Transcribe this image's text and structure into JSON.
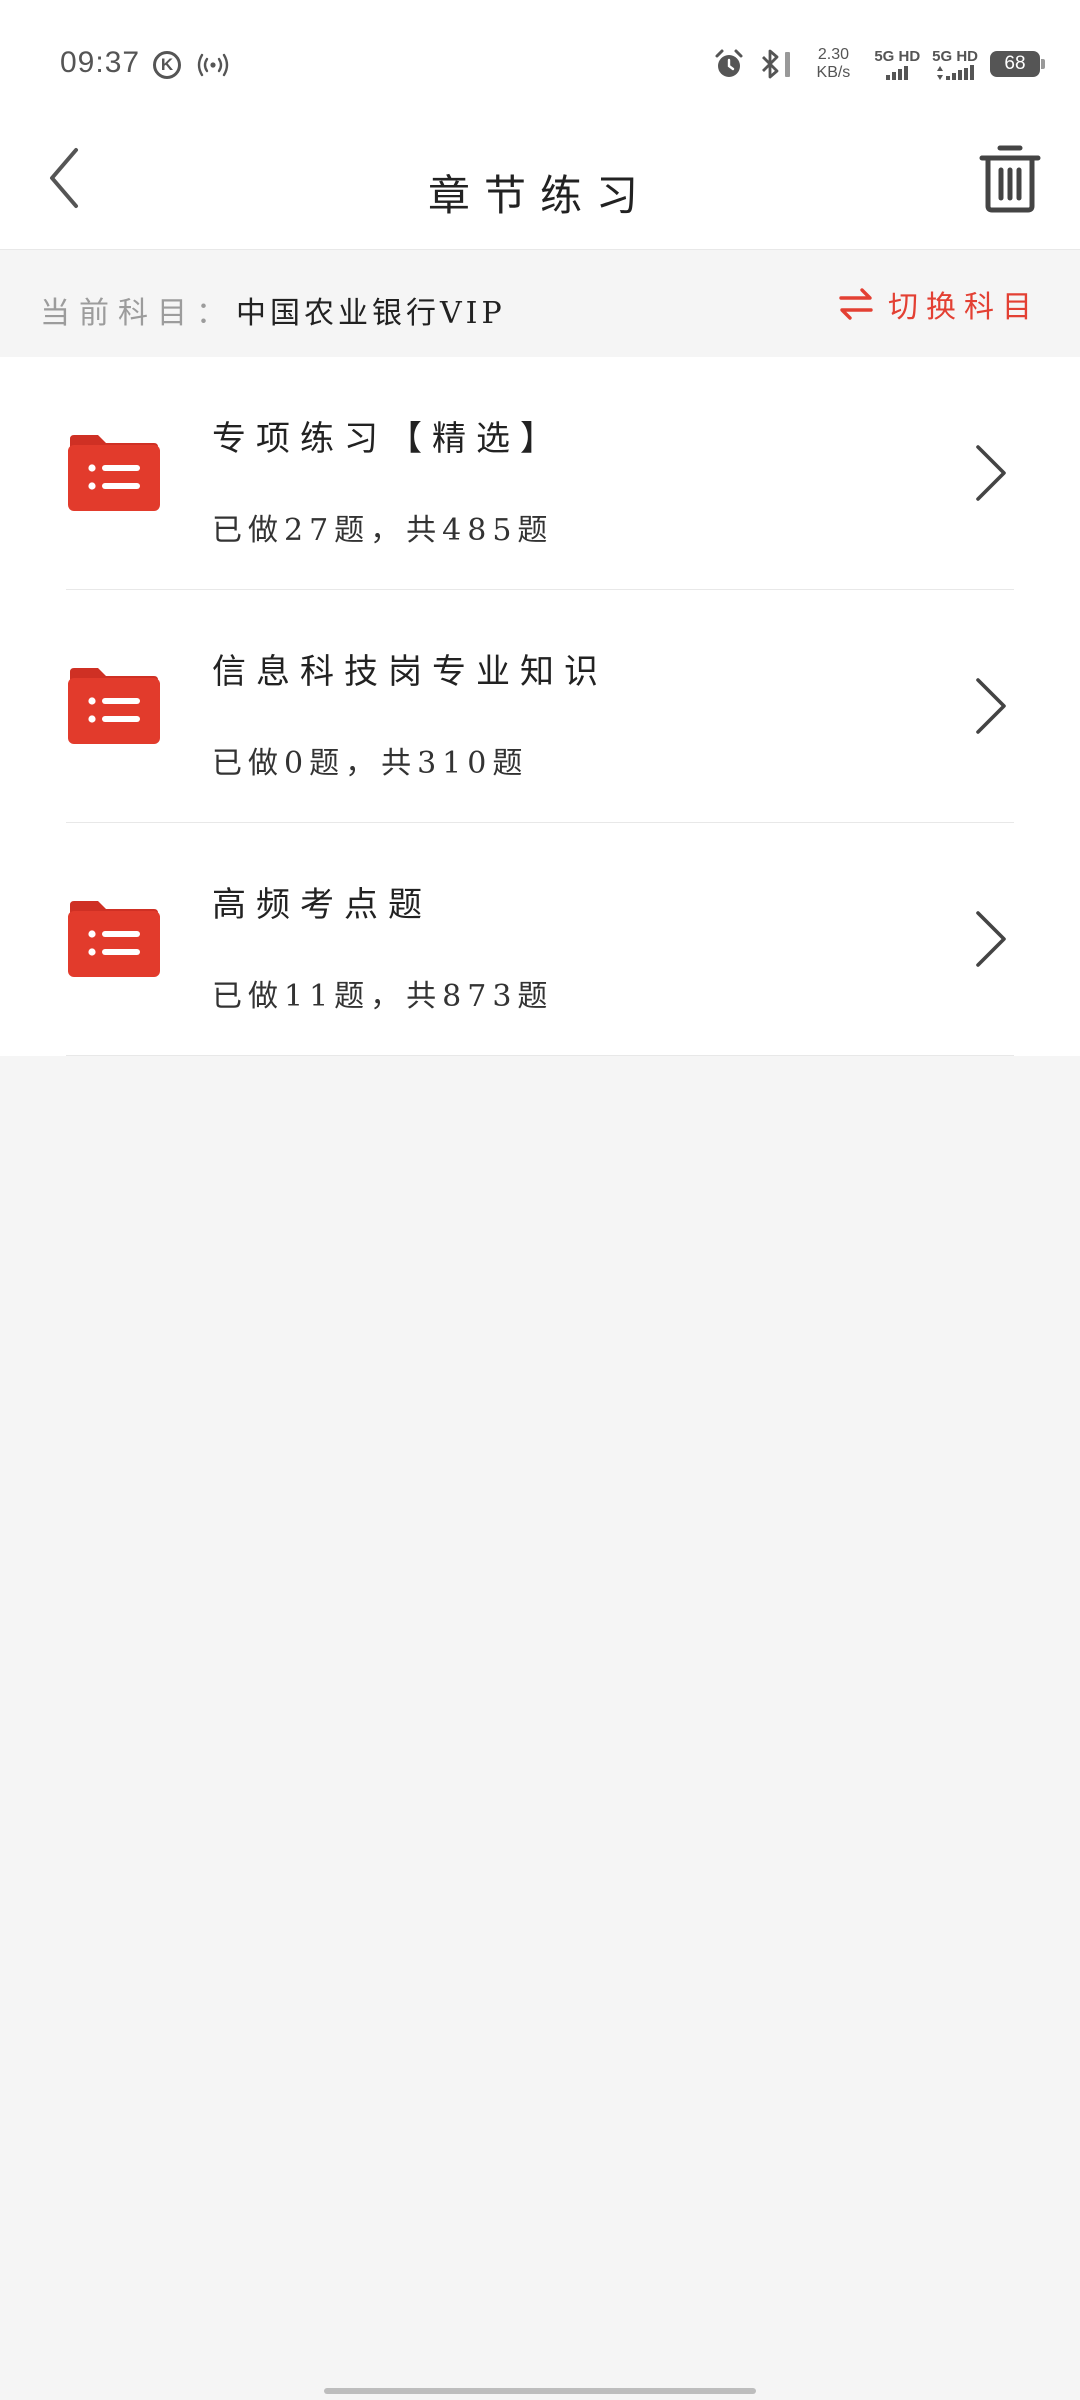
{
  "status_bar": {
    "time": "09:37",
    "k_badge": "K",
    "net_speed_value": "2.30",
    "net_speed_unit": "KB/s",
    "sim1_label": "5G HD",
    "sim2_label": "5G HD",
    "battery_level": "68",
    "icons": [
      "hotspot-icon",
      "alarm-icon",
      "bluetooth-icon",
      "signal-icon"
    ]
  },
  "header": {
    "title": "章节练习",
    "icons": [
      "chevron-left-icon",
      "trash-icon"
    ]
  },
  "subject_bar": {
    "prefix": "当前科目：",
    "subject": "中国农业银行VIP",
    "switch_label": "切换科目",
    "icons": [
      "swap-icon"
    ]
  },
  "sections": [
    {
      "title": "专项练习【精选】",
      "progress": "已做27题，共485题"
    },
    {
      "title": "信息科技岗专业知识",
      "progress": "已做0题，共310题"
    },
    {
      "title": "高频考点题",
      "progress": "已做11题，共873题"
    }
  ],
  "colors": {
    "accent": "#e34033",
    "folder": "#e23b2c",
    "background": "#f5f5f5",
    "surface": "#ffffff",
    "muted_text": "#9c9c9c"
  }
}
